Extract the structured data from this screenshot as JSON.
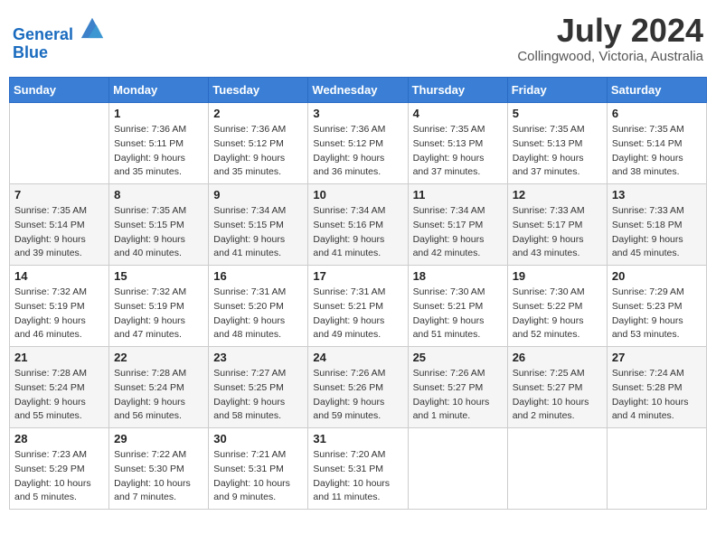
{
  "header": {
    "logo_line1": "General",
    "logo_line2": "Blue",
    "month": "July 2024",
    "location": "Collingwood, Victoria, Australia"
  },
  "columns": [
    "Sunday",
    "Monday",
    "Tuesday",
    "Wednesday",
    "Thursday",
    "Friday",
    "Saturday"
  ],
  "weeks": [
    [
      {
        "day": "",
        "info": ""
      },
      {
        "day": "1",
        "info": "Sunrise: 7:36 AM\nSunset: 5:11 PM\nDaylight: 9 hours\nand 35 minutes."
      },
      {
        "day": "2",
        "info": "Sunrise: 7:36 AM\nSunset: 5:12 PM\nDaylight: 9 hours\nand 35 minutes."
      },
      {
        "day": "3",
        "info": "Sunrise: 7:36 AM\nSunset: 5:12 PM\nDaylight: 9 hours\nand 36 minutes."
      },
      {
        "day": "4",
        "info": "Sunrise: 7:35 AM\nSunset: 5:13 PM\nDaylight: 9 hours\nand 37 minutes."
      },
      {
        "day": "5",
        "info": "Sunrise: 7:35 AM\nSunset: 5:13 PM\nDaylight: 9 hours\nand 37 minutes."
      },
      {
        "day": "6",
        "info": "Sunrise: 7:35 AM\nSunset: 5:14 PM\nDaylight: 9 hours\nand 38 minutes."
      }
    ],
    [
      {
        "day": "7",
        "info": "Sunrise: 7:35 AM\nSunset: 5:14 PM\nDaylight: 9 hours\nand 39 minutes."
      },
      {
        "day": "8",
        "info": "Sunrise: 7:35 AM\nSunset: 5:15 PM\nDaylight: 9 hours\nand 40 minutes."
      },
      {
        "day": "9",
        "info": "Sunrise: 7:34 AM\nSunset: 5:15 PM\nDaylight: 9 hours\nand 41 minutes."
      },
      {
        "day": "10",
        "info": "Sunrise: 7:34 AM\nSunset: 5:16 PM\nDaylight: 9 hours\nand 41 minutes."
      },
      {
        "day": "11",
        "info": "Sunrise: 7:34 AM\nSunset: 5:17 PM\nDaylight: 9 hours\nand 42 minutes."
      },
      {
        "day": "12",
        "info": "Sunrise: 7:33 AM\nSunset: 5:17 PM\nDaylight: 9 hours\nand 43 minutes."
      },
      {
        "day": "13",
        "info": "Sunrise: 7:33 AM\nSunset: 5:18 PM\nDaylight: 9 hours\nand 45 minutes."
      }
    ],
    [
      {
        "day": "14",
        "info": "Sunrise: 7:32 AM\nSunset: 5:19 PM\nDaylight: 9 hours\nand 46 minutes."
      },
      {
        "day": "15",
        "info": "Sunrise: 7:32 AM\nSunset: 5:19 PM\nDaylight: 9 hours\nand 47 minutes."
      },
      {
        "day": "16",
        "info": "Sunrise: 7:31 AM\nSunset: 5:20 PM\nDaylight: 9 hours\nand 48 minutes."
      },
      {
        "day": "17",
        "info": "Sunrise: 7:31 AM\nSunset: 5:21 PM\nDaylight: 9 hours\nand 49 minutes."
      },
      {
        "day": "18",
        "info": "Sunrise: 7:30 AM\nSunset: 5:21 PM\nDaylight: 9 hours\nand 51 minutes."
      },
      {
        "day": "19",
        "info": "Sunrise: 7:30 AM\nSunset: 5:22 PM\nDaylight: 9 hours\nand 52 minutes."
      },
      {
        "day": "20",
        "info": "Sunrise: 7:29 AM\nSunset: 5:23 PM\nDaylight: 9 hours\nand 53 minutes."
      }
    ],
    [
      {
        "day": "21",
        "info": "Sunrise: 7:28 AM\nSunset: 5:24 PM\nDaylight: 9 hours\nand 55 minutes."
      },
      {
        "day": "22",
        "info": "Sunrise: 7:28 AM\nSunset: 5:24 PM\nDaylight: 9 hours\nand 56 minutes."
      },
      {
        "day": "23",
        "info": "Sunrise: 7:27 AM\nSunset: 5:25 PM\nDaylight: 9 hours\nand 58 minutes."
      },
      {
        "day": "24",
        "info": "Sunrise: 7:26 AM\nSunset: 5:26 PM\nDaylight: 9 hours\nand 59 minutes."
      },
      {
        "day": "25",
        "info": "Sunrise: 7:26 AM\nSunset: 5:27 PM\nDaylight: 10 hours\nand 1 minute."
      },
      {
        "day": "26",
        "info": "Sunrise: 7:25 AM\nSunset: 5:27 PM\nDaylight: 10 hours\nand 2 minutes."
      },
      {
        "day": "27",
        "info": "Sunrise: 7:24 AM\nSunset: 5:28 PM\nDaylight: 10 hours\nand 4 minutes."
      }
    ],
    [
      {
        "day": "28",
        "info": "Sunrise: 7:23 AM\nSunset: 5:29 PM\nDaylight: 10 hours\nand 5 minutes."
      },
      {
        "day": "29",
        "info": "Sunrise: 7:22 AM\nSunset: 5:30 PM\nDaylight: 10 hours\nand 7 minutes."
      },
      {
        "day": "30",
        "info": "Sunrise: 7:21 AM\nSunset: 5:31 PM\nDaylight: 10 hours\nand 9 minutes."
      },
      {
        "day": "31",
        "info": "Sunrise: 7:20 AM\nSunset: 5:31 PM\nDaylight: 10 hours\nand 11 minutes."
      },
      {
        "day": "",
        "info": ""
      },
      {
        "day": "",
        "info": ""
      },
      {
        "day": "",
        "info": ""
      }
    ]
  ]
}
